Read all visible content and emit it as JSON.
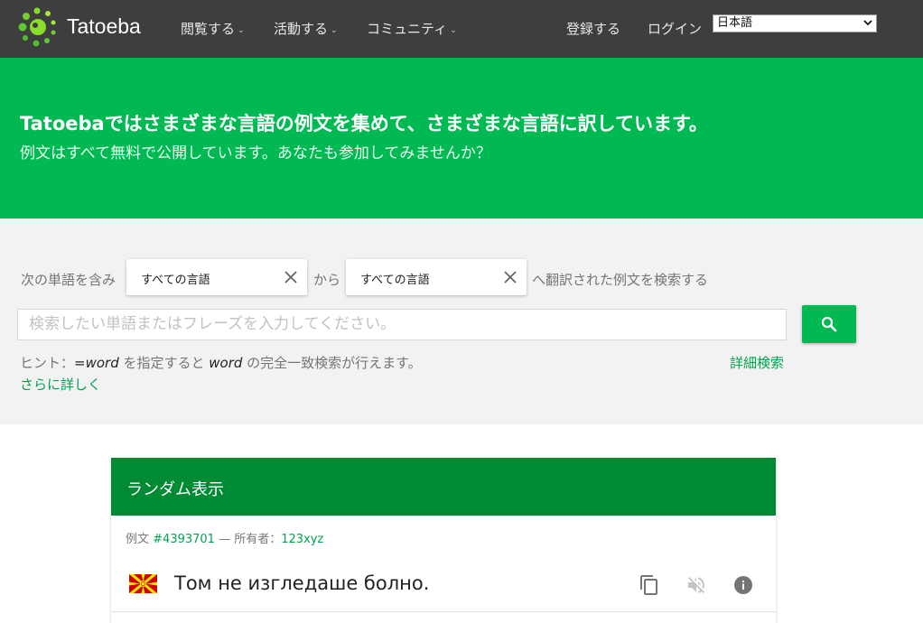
{
  "nav": {
    "brand": "Tatoeba",
    "browse": "閲覧する",
    "activity": "活動する",
    "community": "コミュニティ",
    "register": "登録する",
    "login": "ログイン",
    "language_selected": "日本語"
  },
  "hero": {
    "title": "Tatoebaではさまざまな言語の例文を集めて、さまざまな言語に訳しています。",
    "subtitle": "例文はすべて無料で公開しています。あなたも参加してみませんか？"
  },
  "search": {
    "prefix": "次の単語を含み",
    "from_lang": "すべての言語",
    "middle": "から",
    "to_lang": "すべての言語",
    "suffix": "へ翻訳された例文を検索する",
    "placeholder": "検索したい単語またはフレーズを入力してください。",
    "hint_start": "ヒント：",
    "hint_code": "=word",
    "hint_mid": " を指定すると ",
    "hint_word": "word",
    "hint_end": " の完全一致検索が行えます。",
    "advanced": "詳細検索",
    "more": "さらに詳しく"
  },
  "random": {
    "heading": "ランダム表示",
    "label": "例文",
    "id": "#4393701",
    "owner_label": " — 所有者：",
    "owner": "123xyz",
    "sentence": "Том не изгледаше болно."
  },
  "colors": {
    "green": "#00b953",
    "dark_green": "#008a34",
    "topbar": "#3e3e3e"
  },
  "icons": [
    "tatoeba-logo",
    "chevron-down-icon",
    "close-icon",
    "search-icon",
    "macedonia-flag",
    "copy-icon",
    "audio-off-icon",
    "info-icon"
  ]
}
